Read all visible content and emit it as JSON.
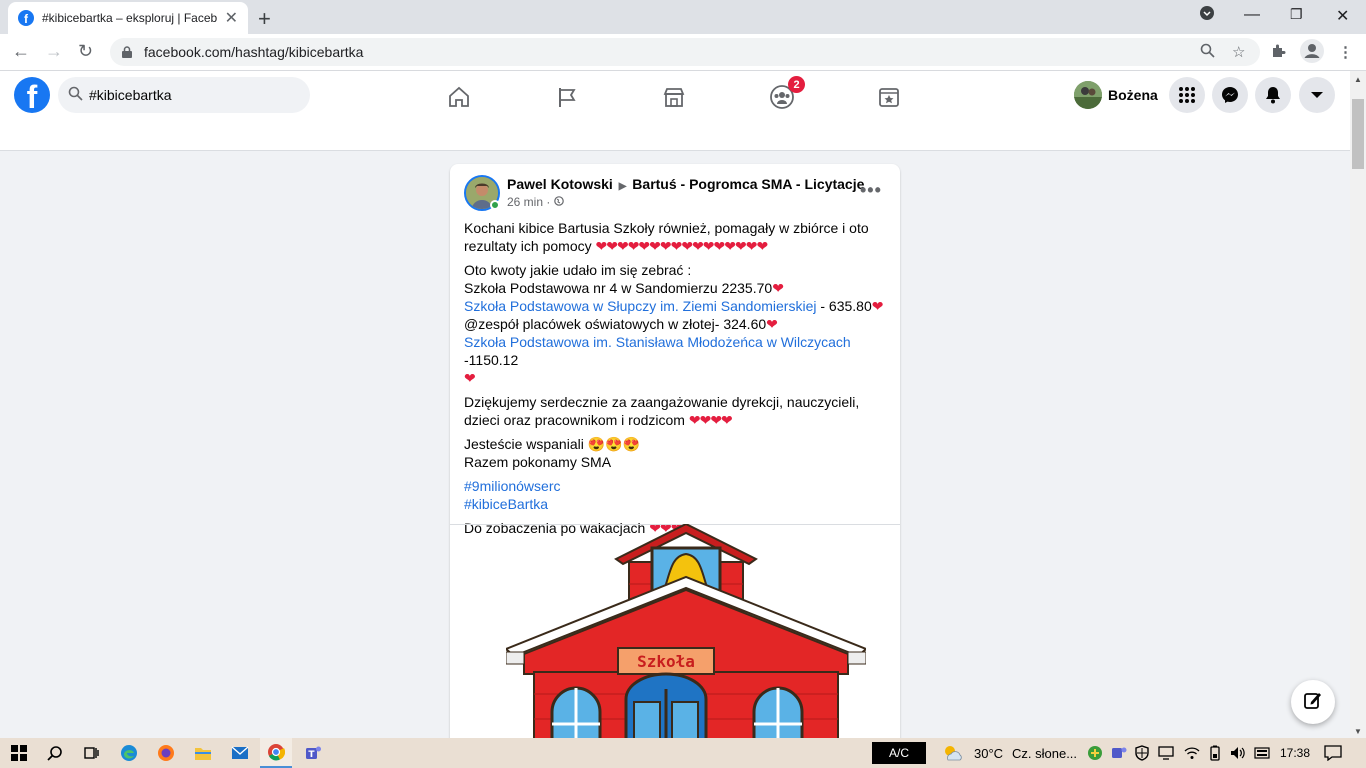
{
  "browser": {
    "tab_title": "#kibicebartka – eksploruj | Faceb",
    "url": "facebook.com/hashtag/kibicebartka"
  },
  "fb": {
    "search_value": "#kibicebartka",
    "groups_badge": "2",
    "profile_name": "Bożena"
  },
  "post": {
    "author": "Pawel Kotowski",
    "group": "Bartuś - Pogromca SMA - Licytacje",
    "time": "26 min",
    "intro": "Kochani kibice Bartusia Szkoły również, pomagały w zbiórce i oto rezultaty ich pomocy",
    "intro_hearts": "❤❤❤❤❤❤❤❤❤❤❤❤❤❤❤❤",
    "amounts_intro": "Oto kwoty jakie udało im się zebrać :",
    "line1": "Szkoła Podstawowa nr 4 w Sandomierzu  2235.70",
    "line2_link": "Szkoła Podstawowa w Słupczy im. Ziemi Sandomierskiej",
    "line2_amount": "  - 635.80",
    "line3": "@zespół placówek oświatowych w złotej- 324.60",
    "line4_link": "Szkoła Podstawowa im. Stanisława Młodożeńca w Wilczycach",
    "line4_amount": " -1150.12",
    "heart": "❤",
    "thanks": "Dziękujemy serdecznie za zaangażowanie dyrekcji, nauczycieli, dzieci oraz pracownikom i rodzicom",
    "thanks_hearts": "❤❤❤❤",
    "great": "Jesteście wspaniali",
    "great_emoji": "😍😍😍",
    "together": "Razem pokonamy SMA",
    "tag1": "#9milionówserc",
    "tag2": "#kibiceBartka",
    "bye": "Do zobaczenia po wakacjach",
    "bye_hearts": "❤❤❤",
    "image_sign": "Szkoła"
  },
  "taskbar": {
    "ac_label": "A/C",
    "temperature": "30°C",
    "weather": "Cz. słone...",
    "clock": "17:38"
  }
}
